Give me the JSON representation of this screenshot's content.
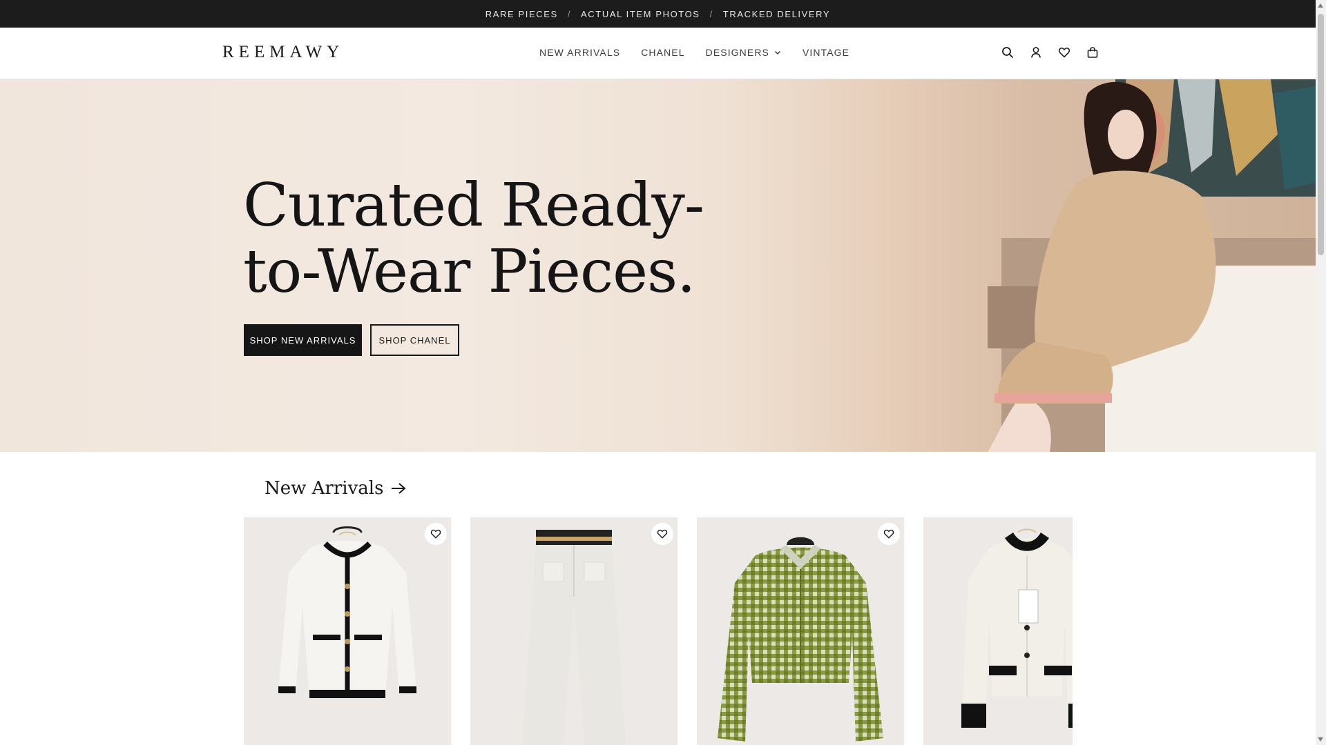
{
  "announcement": {
    "items": [
      "RARE PIECES",
      "ACTUAL ITEM PHOTOS",
      "TRACKED DELIVERY"
    ],
    "separator": "/"
  },
  "header": {
    "logo": "REEMAWY",
    "nav": [
      {
        "label": "NEW ARRIVALS"
      },
      {
        "label": "CHANEL"
      },
      {
        "label": "DESIGNERS",
        "has_dropdown": true
      },
      {
        "label": "VINTAGE"
      }
    ],
    "icons": [
      "search-icon",
      "account-icon",
      "wishlist-icon",
      "cart-icon"
    ]
  },
  "hero": {
    "title_line1": "Curated Ready-",
    "title_line2": "to-Wear Pieces.",
    "primary_button": "SHOP NEW ARRIVALS",
    "secondary_button": "SHOP CHANEL"
  },
  "new_arrivals": {
    "title": "New Arrivals",
    "products": [
      {
        "image": "white-cardigan-black-trim",
        "wishlist_icon": "heart-icon"
      },
      {
        "image": "white-wide-leg-pants",
        "wishlist_icon": "heart-icon"
      },
      {
        "image": "green-houndstooth-tweed-jacket",
        "wishlist_icon": "heart-icon"
      },
      {
        "image": "white-knit-cardigan-black-cuffs",
        "wishlist_icon": null
      }
    ]
  },
  "colors": {
    "announcement_bg": "#1c1c1c",
    "primary": "#161616",
    "hero_bg": "#f1e6dc"
  }
}
